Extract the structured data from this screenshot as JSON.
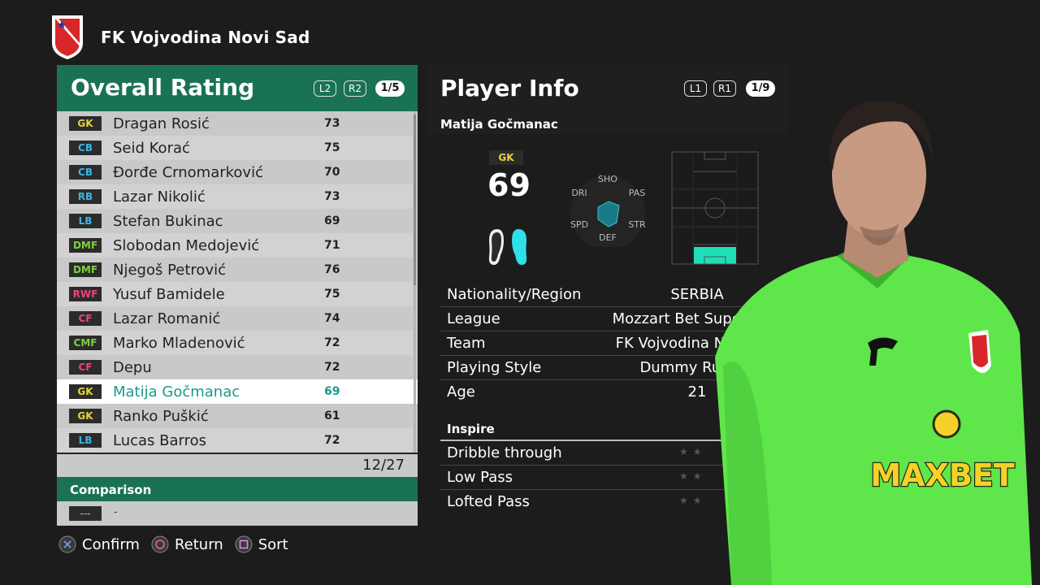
{
  "club": {
    "name": "FK Vojvodina Novi Sad",
    "crest_icon": "club-crest"
  },
  "overall": {
    "title": "Overall Rating",
    "btn_l2": "L2",
    "btn_r2": "R2",
    "page": "1/5",
    "players": [
      {
        "pos": "GK",
        "name": "Dragan Rosić",
        "rating": "73"
      },
      {
        "pos": "CB",
        "name": "Seid Korać",
        "rating": "75"
      },
      {
        "pos": "CB",
        "name": "Đorđe Crnomarković",
        "rating": "70"
      },
      {
        "pos": "RB",
        "name": "Lazar Nikolić",
        "rating": "73"
      },
      {
        "pos": "LB",
        "name": "Stefan Bukinac",
        "rating": "69"
      },
      {
        "pos": "DMF",
        "name": "Slobodan Medojević",
        "rating": "71"
      },
      {
        "pos": "DMF",
        "name": "Njegoš Petrović",
        "rating": "76"
      },
      {
        "pos": "RWF",
        "name": "Yusuf Bamidele",
        "rating": "75"
      },
      {
        "pos": "CF",
        "name": "Lazar Romanić",
        "rating": "74"
      },
      {
        "pos": "CMF",
        "name": "Marko Mladenović",
        "rating": "72"
      },
      {
        "pos": "CF",
        "name": "Depu",
        "rating": "72"
      },
      {
        "pos": "GK",
        "name": "Matija Gočmanac",
        "rating": "69"
      },
      {
        "pos": "GK",
        "name": "Ranko Puškić",
        "rating": "61"
      },
      {
        "pos": "LB",
        "name": "Lucas Barros",
        "rating": "72"
      }
    ],
    "count": "12/27"
  },
  "position_colors": {
    "GK": "#e8d23c",
    "CB": "#39b6e8",
    "RB": "#39b6e8",
    "LB": "#39b6e8",
    "DMF": "#7ed03a",
    "CMF": "#7ed03a",
    "RWF": "#e8457a",
    "CF": "#e8457a"
  },
  "comparison": {
    "title": "Comparison",
    "badge": "---",
    "value": "-"
  },
  "hints": [
    {
      "icon": "cross-button-icon",
      "label": "Confirm"
    },
    {
      "icon": "circle-button-icon",
      "label": "Return"
    },
    {
      "icon": "square-button-icon",
      "label": "Sort"
    }
  ],
  "info": {
    "title": "Player Info",
    "btn_l1": "L1",
    "btn_r1": "R1",
    "page": "1/9",
    "player_name": "Matija Gočmanac",
    "position": "GK",
    "rating": "69",
    "radar_labels": {
      "sho": "SHO",
      "pas": "PAS",
      "str": "STR",
      "def": "DEF",
      "spd": "SPD",
      "dri": "DRI"
    },
    "details": [
      {
        "k": "Nationality/Region",
        "v": "SERBIA"
      },
      {
        "k": "League",
        "v": "Mozzart Bet Super Liga"
      },
      {
        "k": "Team",
        "v": "FK Vojvodina Novi Sad"
      },
      {
        "k": "Playing Style",
        "v": "Dummy Runner"
      },
      {
        "k": "Age",
        "v": "21"
      }
    ],
    "inspire_title": "Inspire",
    "inspire": [
      {
        "k": "Dribble through",
        "stars": "★★"
      },
      {
        "k": "Low Pass",
        "stars": "★★"
      },
      {
        "k": "Lofted Pass",
        "stars": "★★"
      }
    ]
  },
  "kit": {
    "sponsor": "MAXBET"
  },
  "colors": {
    "accent": "#1a7255",
    "highlight": "#1a9a8a",
    "pitch_zone": "#1de0b8",
    "kit": "#5fe64a"
  }
}
